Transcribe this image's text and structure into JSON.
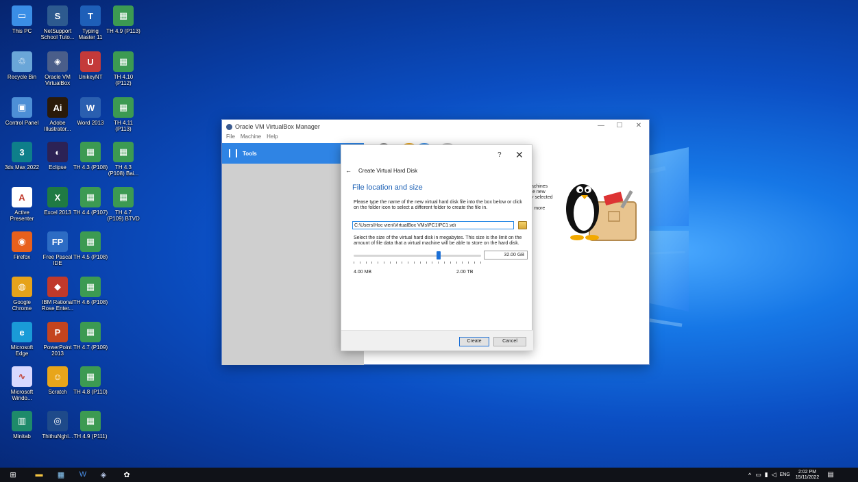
{
  "desktop": {
    "icons": [
      {
        "label": "This PC",
        "name": "this-pc-icon",
        "color": "#3a8ee6",
        "glyph": "▭"
      },
      {
        "label": "NetSupport\nSchool Tuto...",
        "name": "netsupport-icon",
        "color": "#2d5a8f",
        "glyph": "S"
      },
      {
        "label": "Typing\nMaster 11",
        "name": "typing-master-icon",
        "color": "#1e5fb8",
        "glyph": "T"
      },
      {
        "label": "TH 4.9 (P113)",
        "name": "excel-file-icon",
        "color": "#3c9a52",
        "glyph": "▦"
      },
      {
        "label": "Recycle Bin",
        "name": "recycle-bin-icon",
        "color": "#6aa6d8",
        "glyph": "♲"
      },
      {
        "label": "Oracle VM\nVirtualBox",
        "name": "virtualbox-icon",
        "color": "#4a5e8a",
        "glyph": "◈"
      },
      {
        "label": "UnikeyNT",
        "name": "unikey-icon",
        "color": "#c43a3a",
        "glyph": "U"
      },
      {
        "label": "TH 4.10\n(P112)",
        "name": "excel-file-icon",
        "color": "#3c9a52",
        "glyph": "▦"
      },
      {
        "label": "Control Panel",
        "name": "control-panel-icon",
        "color": "#4d8fd6",
        "glyph": "▣"
      },
      {
        "label": "Adobe\nIllustrator...",
        "name": "illustrator-icon",
        "color": "#2a1a0a",
        "glyph": "Ai"
      },
      {
        "label": "Word 2013",
        "name": "word-icon",
        "color": "#2a5fb0",
        "glyph": "W"
      },
      {
        "label": "TH 4.11\n(P113)",
        "name": "excel-file-icon",
        "color": "#3c9a52",
        "glyph": "▦"
      },
      {
        "label": "3ds Max 2022",
        "name": "3dsmax-icon",
        "color": "#0e7f8a",
        "glyph": "3"
      },
      {
        "label": "Eclipse",
        "name": "eclipse-icon",
        "color": "#2c2255",
        "glyph": "◐"
      },
      {
        "label": "TH 4.3 (P108)",
        "name": "excel-file-icon",
        "color": "#3c9a52",
        "glyph": "▦"
      },
      {
        "label": "TH 4.3\n(P108) Bai...",
        "name": "excel-file-icon",
        "color": "#3c9a52",
        "glyph": "▦"
      },
      {
        "label": "Active\nPresenter",
        "name": "activepresenter-icon",
        "color": "#ffffff",
        "glyph": "A"
      },
      {
        "label": "Excel 2013",
        "name": "excel-icon",
        "color": "#1f7a43",
        "glyph": "X"
      },
      {
        "label": "TH 4.4 (P107)",
        "name": "excel-file-icon",
        "color": "#3c9a52",
        "glyph": "▦"
      },
      {
        "label": "TH 4.7\n(P109) BTVD",
        "name": "excel-file-icon",
        "color": "#3c9a52",
        "glyph": "▦"
      },
      {
        "label": "Firefox",
        "name": "firefox-icon",
        "color": "#e8601c",
        "glyph": "◉"
      },
      {
        "label": "Free Pascal\nIDE",
        "name": "free-pascal-icon",
        "color": "#2d6cc4",
        "glyph": "FP"
      },
      {
        "label": "TH 4.5 (P108)",
        "name": "excel-file-icon",
        "color": "#3c9a52",
        "glyph": "▦"
      },
      {
        "label": "",
        "name": "empty-slot",
        "color": "transparent",
        "glyph": ""
      },
      {
        "label": "Google\nChrome",
        "name": "chrome-icon",
        "color": "#e6a31a",
        "glyph": "◍"
      },
      {
        "label": "IBM Rational\nRose Enter...",
        "name": "rational-rose-icon",
        "color": "#c0392b",
        "glyph": "◆"
      },
      {
        "label": "TH 4.6 (P108)",
        "name": "excel-file-icon",
        "color": "#3c9a52",
        "glyph": "▦"
      },
      {
        "label": "",
        "name": "empty-slot",
        "color": "transparent",
        "glyph": ""
      },
      {
        "label": "Microsoft\nEdge",
        "name": "edge-icon",
        "color": "#1a9bd7",
        "glyph": "e"
      },
      {
        "label": "PowerPoint\n2013",
        "name": "powerpoint-icon",
        "color": "#c4441e",
        "glyph": "P"
      },
      {
        "label": "TH 4.7 (P109)",
        "name": "excel-file-icon",
        "color": "#3c9a52",
        "glyph": "▦"
      },
      {
        "label": "",
        "name": "empty-slot",
        "color": "transparent",
        "glyph": ""
      },
      {
        "label": "Microsoft\nWindo...",
        "name": "math-icon",
        "color": "#d8d8ff",
        "glyph": "∿"
      },
      {
        "label": "Scratch",
        "name": "scratch-icon",
        "color": "#e8a51a",
        "glyph": "☺"
      },
      {
        "label": "TH 4.8 (P110)",
        "name": "excel-file-icon",
        "color": "#3c9a52",
        "glyph": "▦"
      },
      {
        "label": "",
        "name": "empty-slot",
        "color": "transparent",
        "glyph": ""
      },
      {
        "label": "Minitab",
        "name": "minitab-icon",
        "color": "#1e8a6a",
        "glyph": "▥"
      },
      {
        "label": "ThithuNghi...",
        "name": "thithu-icon",
        "color": "#1e4a8a",
        "glyph": "◎"
      },
      {
        "label": "TH 4.9 (P111)",
        "name": "excel-file-icon",
        "color": "#3c9a52",
        "glyph": "▦"
      },
      {
        "label": "",
        "name": "empty-slot",
        "color": "transparent",
        "glyph": ""
      }
    ]
  },
  "vbox": {
    "title": "Oracle VM VirtualBox Manager",
    "menu": [
      "File",
      "Machine",
      "Help"
    ],
    "tools_label": "Tools",
    "minimize": "—",
    "maximize": "☐",
    "close": "✕",
    "side_text": "achines\nte new\ny selected\n\nr more"
  },
  "dialog": {
    "help": "?",
    "close": "✕",
    "back": "←",
    "heading": "Create Virtual Hard Disk",
    "section_title": "File location and size",
    "intro": "Please type the name of the new virtual hard disk file into the box below or click on the folder icon to select a different folder to create the file in.",
    "path_value": "C:\\Users\\Hoc vien\\VirtualBox VMs\\PC1\\PC1.vdi",
    "size_text": "Select the size of the virtual hard disk in megabytes. This size is the limit on the amount of file data that a virtual machine will be able to store on the hard disk.",
    "size_value": "32.00 GB",
    "min_label": "4.00 MB",
    "max_label": "2.00 TB",
    "create_label": "Create",
    "cancel_label": "Cancel"
  },
  "taskbar": {
    "lang": "ENG",
    "time": "2:02 PM",
    "date": "15/11/2022"
  }
}
